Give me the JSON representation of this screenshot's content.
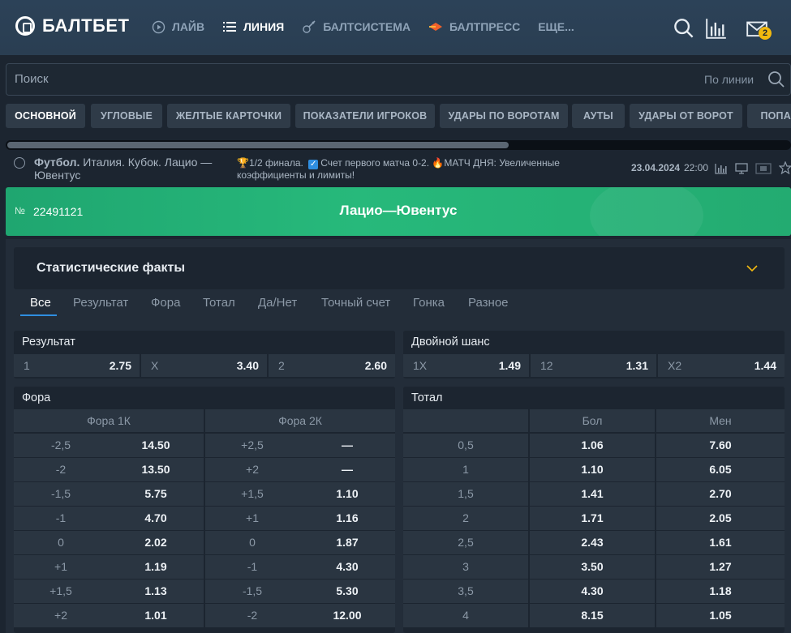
{
  "brand": {
    "name": "БАЛТБЕТ"
  },
  "nav": [
    {
      "label": "ЛАЙВ",
      "icon": "play-icon",
      "active": false
    },
    {
      "label": "ЛИНИЯ",
      "icon": "list-icon",
      "active": true
    },
    {
      "label": "БАЛТСИСТЕМА",
      "icon": "guitar-icon",
      "active": false
    },
    {
      "label": "БАЛТПРЕСС",
      "icon": "press-icon",
      "active": false
    },
    {
      "label": "ЕЩЕ...",
      "icon": "",
      "active": false
    }
  ],
  "header_icons": {
    "search": "search-icon",
    "stats": "bar-chart-icon",
    "mail": "mail-icon",
    "mail_badge": "2"
  },
  "search": {
    "placeholder": "Поиск",
    "scope": "По линии"
  },
  "chips": [
    "ОСНОВНОЙ",
    "УГЛОВЫЕ",
    "ЖЕЛТЫЕ КАРТОЧКИ",
    "ПОКАЗАТЕЛИ ИГРОКОВ",
    "УДАРЫ ПО ВОРОТАМ",
    "АУТЫ",
    "УДАРЫ ОТ ВОРОТ",
    "ПОПАД"
  ],
  "event": {
    "sport": "Футбол.",
    "title_rest": "Италия. Кубок. Лацио — Ювентус",
    "note_1": "1/2 финала.",
    "note_2": "Счет первого матча 0-2.",
    "note_3": "МАТЧ ДНЯ: Увеличенные коэффициенты и лимиты!",
    "date": "23.04.2024",
    "time": "22:00"
  },
  "match": {
    "number_label": "№",
    "number": "22491121",
    "title": "Лацио—Ювентус"
  },
  "stats": {
    "title": "Статистические факты"
  },
  "tabs": [
    "Все",
    "Результат",
    "Фора",
    "Тотал",
    "Да/Нет",
    "Точный счет",
    "Гонка",
    "Разное"
  ],
  "result": {
    "title": "Результат",
    "cells": [
      {
        "label": "1",
        "odd": "2.75"
      },
      {
        "label": "X",
        "odd": "3.40"
      },
      {
        "label": "2",
        "odd": "2.60"
      }
    ]
  },
  "double_chance": {
    "title": "Двойной шанс",
    "cells": [
      {
        "label": "1X",
        "odd": "1.49"
      },
      {
        "label": "12",
        "odd": "1.31"
      },
      {
        "label": "X2",
        "odd": "1.44"
      }
    ]
  },
  "handicap": {
    "title": "Фора",
    "col1": "Фора 1К",
    "col2": "Фора 2К",
    "rows": [
      {
        "h1": "-2,5",
        "o1": "14.50",
        "h2": "+2,5",
        "o2": "—"
      },
      {
        "h1": "-2",
        "o1": "13.50",
        "h2": "+2",
        "o2": "—"
      },
      {
        "h1": "-1,5",
        "o1": "5.75",
        "h2": "+1,5",
        "o2": "1.10"
      },
      {
        "h1": "-1",
        "o1": "4.70",
        "h2": "+1",
        "o2": "1.16"
      },
      {
        "h1": "0",
        "o1": "2.02",
        "h2": "0",
        "o2": "1.87"
      },
      {
        "h1": "+1",
        "o1": "1.19",
        "h2": "-1",
        "o2": "4.30"
      },
      {
        "h1": "+1,5",
        "o1": "1.13",
        "h2": "-1,5",
        "o2": "5.30"
      },
      {
        "h1": "+2",
        "o1": "1.01",
        "h2": "-2",
        "o2": "12.00"
      }
    ]
  },
  "total": {
    "title": "Тотал",
    "col_over": "Бол",
    "col_under": "Мен",
    "rows": [
      {
        "t": "0,5",
        "over": "1.06",
        "under": "7.60"
      },
      {
        "t": "1",
        "over": "1.10",
        "under": "6.05"
      },
      {
        "t": "1,5",
        "over": "1.41",
        "under": "2.70"
      },
      {
        "t": "2",
        "over": "1.71",
        "under": "2.05"
      },
      {
        "t": "2,5",
        "over": "2.43",
        "under": "1.61"
      },
      {
        "t": "3",
        "over": "3.50",
        "under": "1.27"
      },
      {
        "t": "3,5",
        "over": "4.30",
        "under": "1.18"
      },
      {
        "t": "4",
        "over": "8.15",
        "under": "1.05"
      }
    ]
  }
}
